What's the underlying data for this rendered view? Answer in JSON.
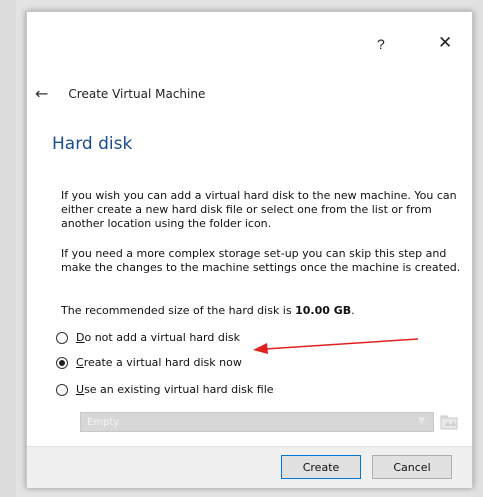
{
  "window": {
    "help_label": "?",
    "close_label": "✕"
  },
  "nav": {
    "back_icon": "back-arrow-icon",
    "title": "Create Virtual Machine"
  },
  "page": {
    "title": "Hard disk",
    "paragraph1": "If you wish you can add a virtual hard disk to the new machine. You can either create a new hard disk file or select one from the list or from another location using the folder icon.",
    "paragraph2": "If you need a more complex storage set-up you can skip this step and make the changes to the machine settings once the machine is created.",
    "recommended_prefix": "The recommended size of the hard disk is ",
    "recommended_size": "10.00 GB",
    "recommended_suffix": "."
  },
  "options": [
    {
      "mnemonic": "D",
      "rest": "o not add a virtual hard disk",
      "selected": false
    },
    {
      "mnemonic": "C",
      "rest": "reate a virtual hard disk now",
      "selected": true
    },
    {
      "mnemonic": "U",
      "rest": "se an existing virtual hard disk file",
      "selected": false
    }
  ],
  "disk_select": {
    "value": "Empty",
    "enabled": false
  },
  "buttons": {
    "create": "Create",
    "cancel": "Cancel"
  },
  "colors": {
    "accent_title": "#1a4d8f",
    "annotation_arrow": "#e02020",
    "primary_border": "#0078d7"
  }
}
